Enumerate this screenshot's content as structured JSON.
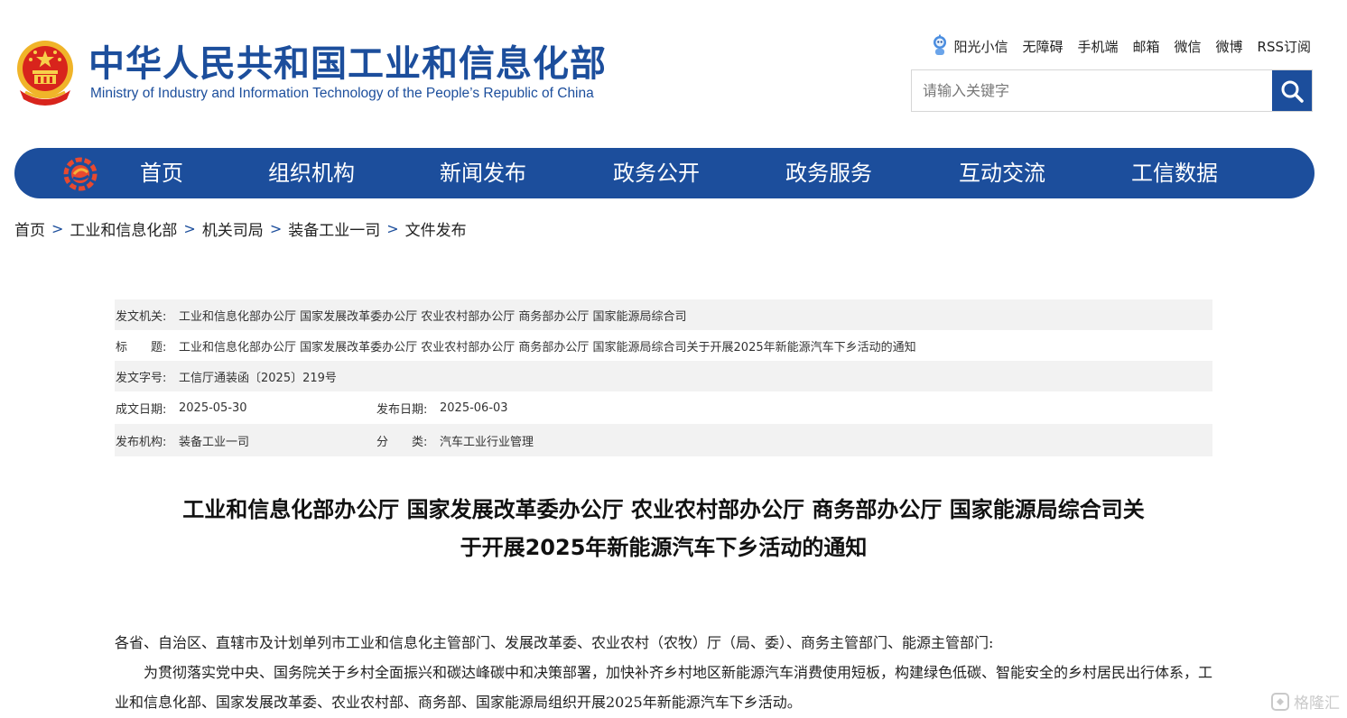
{
  "header": {
    "title": "中华人民共和国工业和信息化部",
    "subtitle": "Ministry of Industry and Information Technology of the People’s Republic of China",
    "top_links": [
      "阳光小信",
      "无障碍",
      "手机端",
      "邮箱",
      "微信",
      "微博",
      "RSS订阅"
    ],
    "search": {
      "placeholder": "请输入关键字"
    }
  },
  "nav": {
    "items": [
      "首页",
      "组织机构",
      "新闻发布",
      "政务公开",
      "政务服务",
      "互动交流",
      "工信数据"
    ]
  },
  "breadcrumb": [
    "首页",
    "工业和信息化部",
    "机关司局",
    "装备工业一司",
    "文件发布"
  ],
  "meta": {
    "issuer_label": "发文机关:",
    "issuer": "工业和信息化部办公厅 国家发展改革委办公厅 农业农村部办公厅 商务部办公厅 国家能源局综合司",
    "title_label": "标　　题:",
    "title": "工业和信息化部办公厅 国家发展改革委办公厅 农业农村部办公厅 商务部办公厅 国家能源局综合司关于开展2025年新能源汽车下乡活动的通知",
    "doc_no_label": "发文字号:",
    "doc_no": "工信厅通装函〔2025〕219号",
    "written_label": "成文日期:",
    "written": "2025-05-30",
    "published_label": "发布日期:",
    "published": "2025-06-03",
    "org_label": "发布机构:",
    "org": "装备工业一司",
    "category_label": "分　　类:",
    "category": "汽车工业行业管理"
  },
  "article": {
    "title_line1": "工业和信息化部办公厅 国家发展改革委办公厅 农业农村部办公厅 商务部办公厅 国家能源局综合司关",
    "title_line2": "于开展2025年新能源汽车下乡活动的通知",
    "salutation": "各省、自治区、直辖市及计划单列市工业和信息化主管部门、发展改革委、农业农村（农牧）厅（局、委）、商务主管部门、能源主管部门:",
    "para1": "为贯彻落实党中央、国务院关于乡村全面振兴和碳达峰碳中和决策部署，加快补齐乡村地区新能源汽车消费使用短板，构建绿色低碳、智能安全的乡村居民出行体系，工业和信息化部、国家发展改革委、农业农村部、商务部、国家能源局组织开展2025年新能源汽车下乡活动。"
  },
  "watermark": {
    "text": "格隆汇"
  },
  "colors": {
    "brand_blue": "#1c4e9c",
    "row_shade": "#f2f2f2"
  }
}
